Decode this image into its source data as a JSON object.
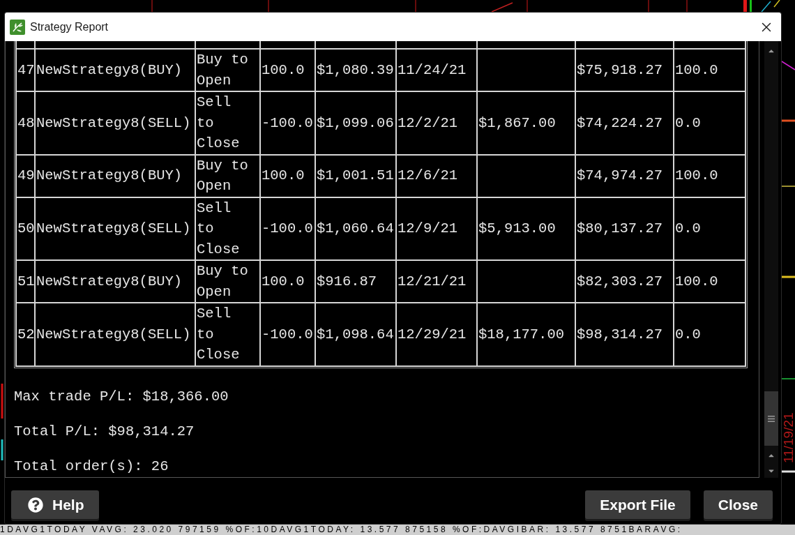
{
  "window": {
    "title": "Strategy Report"
  },
  "table": {
    "rows": [
      {
        "cells": [
          "47",
          "NewStrategy8(BUY)",
          "Buy to Open",
          "100.0",
          "$1,080.39",
          "11/24/21",
          null,
          "$75,918.27",
          "100.0"
        ]
      },
      {
        "cells": [
          "48",
          "NewStrategy8(SELL)",
          "Sell to Close",
          "-100.0",
          "$1,099.06",
          "12/2/21",
          "$1,867.00",
          "$74,224.27",
          "0.0"
        ]
      },
      {
        "cells": [
          "49",
          "NewStrategy8(BUY)",
          "Buy to Open",
          "100.0",
          "$1,001.51",
          "12/6/21",
          null,
          "$74,974.27",
          "100.0"
        ]
      },
      {
        "cells": [
          "50",
          "NewStrategy8(SELL)",
          "Sell to Close",
          "-100.0",
          "$1,060.64",
          "12/9/21",
          "$5,913.00",
          "$80,137.27",
          "0.0"
        ]
      },
      {
        "cells": [
          "51",
          "NewStrategy8(BUY)",
          "Buy to Open",
          "100.0",
          "$916.87",
          "12/21/21",
          null,
          "$82,303.27",
          "100.0"
        ]
      },
      {
        "cells": [
          "52",
          "NewStrategy8(SELL)",
          "Sell to Close",
          "-100.0",
          "$1,098.64",
          "12/29/21",
          "$18,177.00",
          "$98,314.27",
          "0.0"
        ]
      }
    ]
  },
  "summary": [
    "Max trade P/L: $18,366.00",
    "Total P/L: $98,314.27",
    "Total order(s): 26"
  ],
  "buttons": [
    {
      "label": "Help",
      "kind": "help"
    },
    {
      "label": "Export File",
      "kind": "plain"
    },
    {
      "label": "Close",
      "kind": "plain"
    }
  ],
  "background": {
    "date_label": "11/19/21",
    "status_text": "1DAVG1TODAY VAVG: 23.020 797159 %OF:10DAVG1TODAY: 13.577 875158 %OF:DAVGIBAR: 13.577 8751BARAVG:"
  }
}
